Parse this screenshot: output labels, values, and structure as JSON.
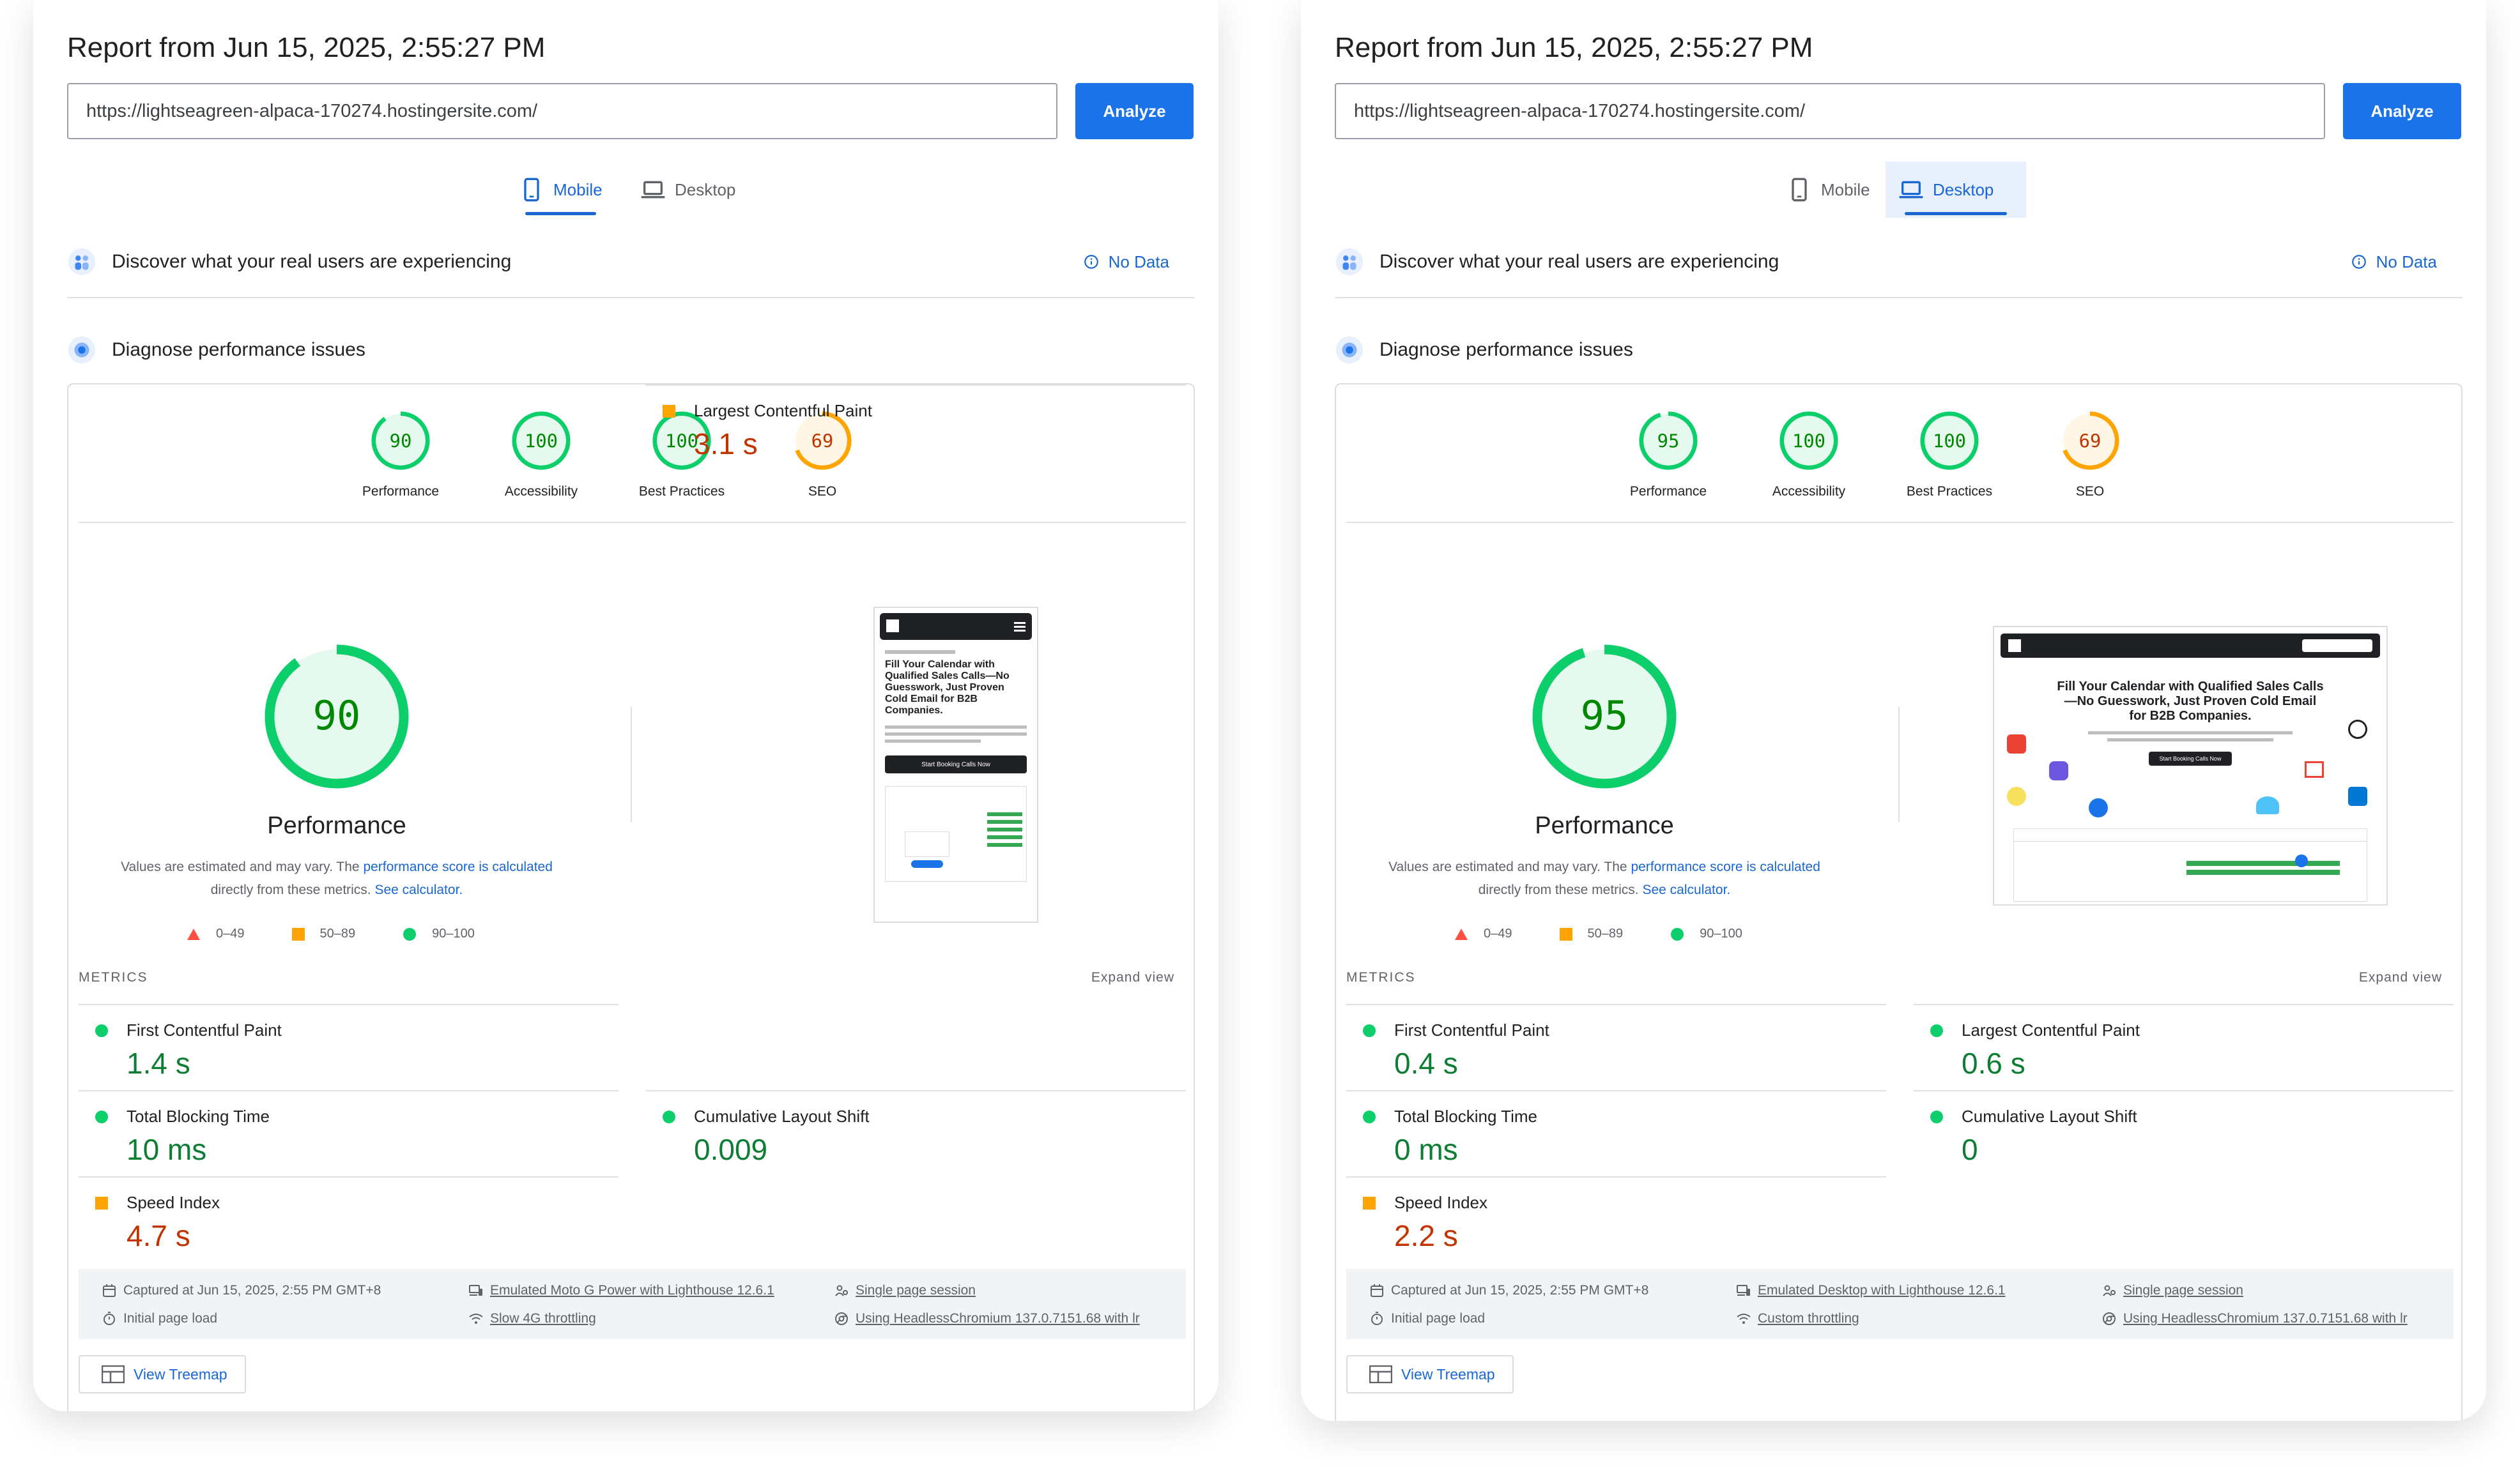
{
  "panels": [
    {
      "id": "mobile",
      "title": "Report from Jun 15, 2025, 2:55:27 PM",
      "url": "https://lightseagreen-alpaca-170274.hostingersite.com/",
      "analyze_label": "Analyze",
      "tabs": [
        {
          "label": "Mobile",
          "active": true
        },
        {
          "label": "Desktop",
          "active": false
        }
      ],
      "field_data": {
        "label": "Discover what your real users are experiencing",
        "status": "No Data"
      },
      "diagnose_label": "Diagnose performance issues",
      "gauges": [
        {
          "label": "Performance",
          "score": 90
        },
        {
          "label": "Accessibility",
          "score": 100
        },
        {
          "label": "Best Practices",
          "score": 100
        },
        {
          "label": "SEO",
          "score": 69
        }
      ],
      "perf": {
        "score": 90,
        "title": "Performance",
        "desc_1": "Values are estimated and may vary. The ",
        "desc_link_1": "performance score is calculated",
        "desc_2": " directly from these metrics. ",
        "desc_link_2": "See calculator."
      },
      "legend": [
        "0–49",
        "50–89",
        "90–100"
      ],
      "metrics_header": "METRICS",
      "expand_label": "Expand view",
      "metrics": [
        {
          "name": "First Contentful Paint",
          "value": "1.4 s",
          "rating": "good"
        },
        {
          "name": "Largest Contentful Paint",
          "value": "3.1 s",
          "rating": "average"
        },
        {
          "name": "Total Blocking Time",
          "value": "10 ms",
          "rating": "good"
        },
        {
          "name": "Cumulative Layout Shift",
          "value": "0.009",
          "rating": "good"
        },
        {
          "name": "Speed Index",
          "value": "4.7 s",
          "rating": "average"
        }
      ],
      "footer": {
        "captured": "Captured at Jun 15, 2025, 2:55 PM GMT+8",
        "load": "Initial page load",
        "device": "Emulated Moto G Power with Lighthouse 12.6.1",
        "throttling": "Slow 4G throttling",
        "session": "Single page session",
        "browser": "Using HeadlessChromium 137.0.7151.68 with lr"
      },
      "treemap_label": "View Treemap",
      "preview": {
        "headline": "Fill Your Calendar with Qualified Sales Calls—No Guesswork, Just Proven Cold Email for B2B Companies.",
        "cta": "Start Booking Calls Now"
      }
    },
    {
      "id": "desktop",
      "title": "Report from Jun 15, 2025, 2:55:27 PM",
      "url": "https://lightseagreen-alpaca-170274.hostingersite.com/",
      "analyze_label": "Analyze",
      "tabs": [
        {
          "label": "Mobile",
          "active": false
        },
        {
          "label": "Desktop",
          "active": true
        }
      ],
      "field_data": {
        "label": "Discover what your real users are experiencing",
        "status": "No Data"
      },
      "diagnose_label": "Diagnose performance issues",
      "gauges": [
        {
          "label": "Performance",
          "score": 95
        },
        {
          "label": "Accessibility",
          "score": 100
        },
        {
          "label": "Best Practices",
          "score": 100
        },
        {
          "label": "SEO",
          "score": 69
        }
      ],
      "perf": {
        "score": 95,
        "title": "Performance",
        "desc_1": "Values are estimated and may vary. The ",
        "desc_link_1": "performance score is calculated",
        "desc_2": " directly from these metrics. ",
        "desc_link_2": "See calculator."
      },
      "legend": [
        "0–49",
        "50–89",
        "90–100"
      ],
      "metrics_header": "METRICS",
      "expand_label": "Expand view",
      "metrics": [
        {
          "name": "First Contentful Paint",
          "value": "0.4 s",
          "rating": "good"
        },
        {
          "name": "Largest Contentful Paint",
          "value": "0.6 s",
          "rating": "good"
        },
        {
          "name": "Total Blocking Time",
          "value": "0 ms",
          "rating": "good"
        },
        {
          "name": "Cumulative Layout Shift",
          "value": "0",
          "rating": "good"
        },
        {
          "name": "Speed Index",
          "value": "2.2 s",
          "rating": "average"
        }
      ],
      "footer": {
        "captured": "Captured at Jun 15, 2025, 2:55 PM GMT+8",
        "load": "Initial page load",
        "device": "Emulated Desktop with Lighthouse 12.6.1",
        "throttling": "Custom throttling",
        "session": "Single page session",
        "browser": "Using HeadlessChromium 137.0.7151.68 with lr"
      },
      "treemap_label": "View Treemap",
      "preview": {
        "headline": "Fill Your Calendar with Qualified Sales Calls—No Guesswork, Just Proven Cold Email for B2B Companies.",
        "cta": "Start Booking Calls Now"
      }
    }
  ],
  "colors": {
    "good": "#0cce6b",
    "good_text": "#008800",
    "average": "#ffa400",
    "average_text": "#c33300",
    "poor": "#ff4e42",
    "accent": "#1a73e8"
  }
}
